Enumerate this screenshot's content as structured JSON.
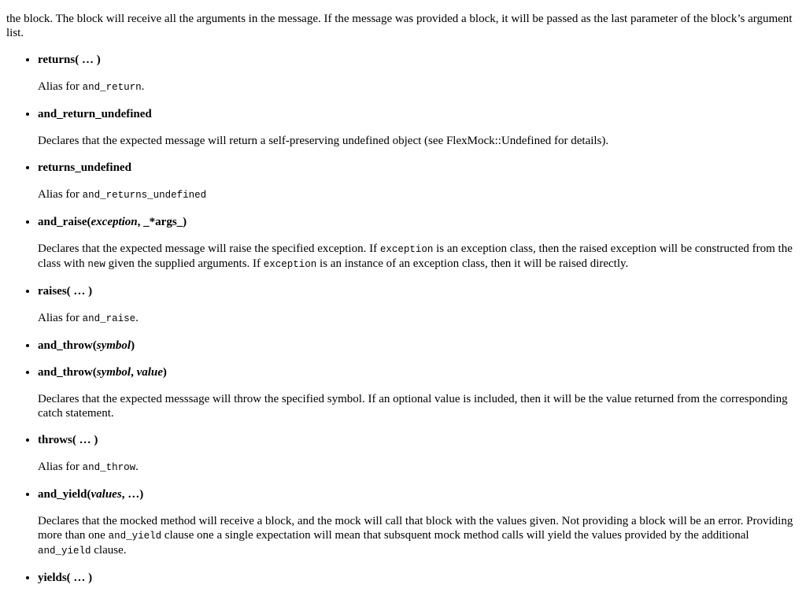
{
  "intro": "the block. The block will receive all the arguments in the message. If the message was provided a block, it will be passed as the last parameter of the block’s argument list.",
  "items": [
    {
      "term": [
        [
          "returns( … )",
          ""
        ]
      ],
      "desc": [
        [
          "Alias for ",
          ""
        ],
        [
          "and_return",
          "code"
        ],
        [
          ".",
          ""
        ]
      ]
    },
    {
      "term": [
        [
          "and_return_undefined",
          ""
        ]
      ],
      "desc": [
        [
          "Declares that the expected message will return a self-preserving undefined object (see FlexMock::Undefined for details).",
          ""
        ]
      ]
    },
    {
      "term": [
        [
          "returns_undefined",
          ""
        ]
      ],
      "desc": [
        [
          "Alias for ",
          ""
        ],
        [
          "and_returns_undefined",
          "code"
        ]
      ]
    },
    {
      "term": [
        [
          "and_raise(",
          ""
        ],
        [
          "exception",
          "i"
        ],
        [
          ", _*args_)",
          ""
        ]
      ],
      "desc": [
        [
          "Declares that the expected message will raise the specified exception. If ",
          ""
        ],
        [
          "exception",
          "code"
        ],
        [
          " is an exception class, then the raised exception will be constructed from the class with ",
          ""
        ],
        [
          "new",
          "code"
        ],
        [
          " given the supplied arguments. If ",
          ""
        ],
        [
          "exception",
          "code"
        ],
        [
          " is an instance of an exception class, then it will be raised directly.",
          ""
        ]
      ]
    },
    {
      "term": [
        [
          "raises( … )",
          ""
        ]
      ],
      "desc": [
        [
          "Alias for ",
          ""
        ],
        [
          "and_raise",
          "code"
        ],
        [
          ".",
          ""
        ]
      ]
    },
    {
      "term": [
        [
          "and_throw(",
          ""
        ],
        [
          "symbol",
          "i"
        ],
        [
          ")",
          ""
        ]
      ],
      "desc": []
    },
    {
      "term": [
        [
          "and_throw(",
          ""
        ],
        [
          "symbol",
          "i"
        ],
        [
          ", ",
          ""
        ],
        [
          "value",
          "i"
        ],
        [
          ")",
          ""
        ]
      ],
      "desc": [
        [
          "Declares that the expected messsage will throw the specified symbol. If an optional value is included, then it will be the value returned from the corresponding catch statement.",
          ""
        ]
      ]
    },
    {
      "term": [
        [
          "throws( … )",
          ""
        ]
      ],
      "desc": [
        [
          "Alias for ",
          ""
        ],
        [
          "and_throw",
          "code"
        ],
        [
          ".",
          ""
        ]
      ]
    },
    {
      "term": [
        [
          "and_yield(",
          ""
        ],
        [
          "values",
          "i"
        ],
        [
          ", …)",
          ""
        ]
      ],
      "desc": [
        [
          "Declares that the mocked method will receive a block, and the mock will call that block with the values given. Not providing a block will be an error. Providing more than one ",
          ""
        ],
        [
          "and_yield",
          "code"
        ],
        [
          " clause one a single expectation will mean that subsquent mock method calls will yield the values provided by the additional ",
          ""
        ],
        [
          "and_yield",
          "code"
        ],
        [
          " clause.",
          ""
        ]
      ]
    },
    {
      "term": [
        [
          "yields( … )",
          ""
        ]
      ],
      "desc": []
    }
  ]
}
